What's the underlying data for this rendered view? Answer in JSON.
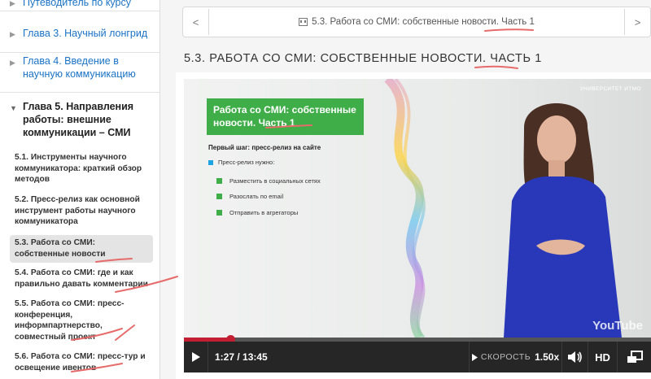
{
  "sidebar": {
    "guide": "Путеводитель по курсу",
    "chapter3": "Глава 3. Научный лонгрид",
    "chapter4": "Глава 4. Введение в научную коммуникацию",
    "chapter5": "Глава 5. Направления работы: внешние коммуникации – СМИ",
    "subsections": [
      "5.1. Инструменты научного коммуникатора: краткий обзор методов",
      "5.2. Пресс-релиз как основной инструмент работы научного коммуникатора",
      "5.3. Работа со СМИ: собственные новости",
      "5.4. Работа со СМИ: где и как правильно давать комментарии",
      "5.5. Работа со СМИ: пресс-конференция, информпартнерство, совместный проект",
      "5.6. Работа со СМИ: пресс-тур и освещение ивентов"
    ]
  },
  "course_nav": {
    "prev": "<",
    "next": ">",
    "current": "5.3. Работа со СМИ: собственные новости. Часть 1"
  },
  "unit": {
    "title": "5.3. РАБОТА СО СМИ: СОБСТВЕННЫЕ НОВОСТИ. ЧАСТЬ 1"
  },
  "video": {
    "logo": "УНИВЕРСИТЕТ ИТМО",
    "slide_title": "Работа со СМИ: собственные новости. Часть 1",
    "first_step": "Первый шаг: пресс-релиз на сайте",
    "main_bullet": "Пресс-релиз нужно:",
    "sub_bullets": [
      "Разместить в социальных сетях",
      "Разослать по email",
      "Отправить в агрегаторы"
    ],
    "watermark": "YouTube",
    "progress": 0.1
  },
  "controls": {
    "time": "1:27 / 13:45",
    "speed_label": "СКОРОСТЬ",
    "speed_value": "1.50x",
    "hd": "HD"
  },
  "colors": {
    "link": "#1a73c6",
    "slide_green": "#3fae49",
    "bullet_blue": "#1ea3e1",
    "progress_red": "#c31f33",
    "annotation": "#e76b6b"
  }
}
